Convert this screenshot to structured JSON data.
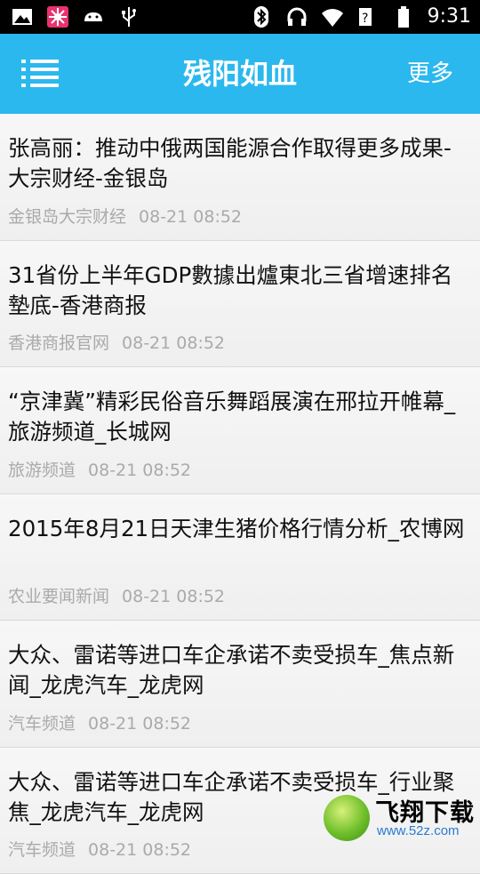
{
  "status_bar": {
    "left_icons": [
      "image-icon",
      "flower-icon",
      "android-icon",
      "usb-icon"
    ],
    "right_icons": [
      "bluetooth-icon",
      "headphones-icon",
      "wifi-icon",
      "signal-icon",
      "battery-icon"
    ],
    "time": "9:31"
  },
  "app_bar": {
    "menu_icon": "hamburger-menu-icon",
    "title": "残阳如血",
    "more_label": "更多",
    "color": "#2bb8ee"
  },
  "feed": {
    "items": [
      {
        "title": "张高丽：推动中俄两国能源合作取得更多成果-大宗财经-金银岛",
        "source": "金银岛大宗财经",
        "time": "08-21 08:52"
      },
      {
        "title": "31省份上半年GDP數據出爐東北三省增速排名墊底-香港商报",
        "source": "香港商报官网",
        "time": "08-21 08:52"
      },
      {
        "title": "“京津冀”精彩民俗音乐舞蹈展演在邢拉开帷幕_旅游频道_长城网",
        "source": "旅游频道",
        "time": "08-21 08:52"
      },
      {
        "title": "2015年8月21日天津生猪价格行情分析_农博网",
        "source": "农业要闻新闻",
        "time": "08-21 08:52"
      },
      {
        "title": "大众、雷诺等进口车企承诺不卖受损车_焦点新闻_龙虎汽车_龙虎网",
        "source": "汽车频道",
        "time": "08-21 08:52"
      },
      {
        "title": "大众、雷诺等进口车企承诺不卖受损车_行业聚焦_龙虎汽车_龙虎网",
        "source": "汽车频道",
        "time": "08-21 08:52"
      }
    ]
  },
  "watermark": {
    "text": "飞翔下载",
    "url": "www.52z.com"
  }
}
